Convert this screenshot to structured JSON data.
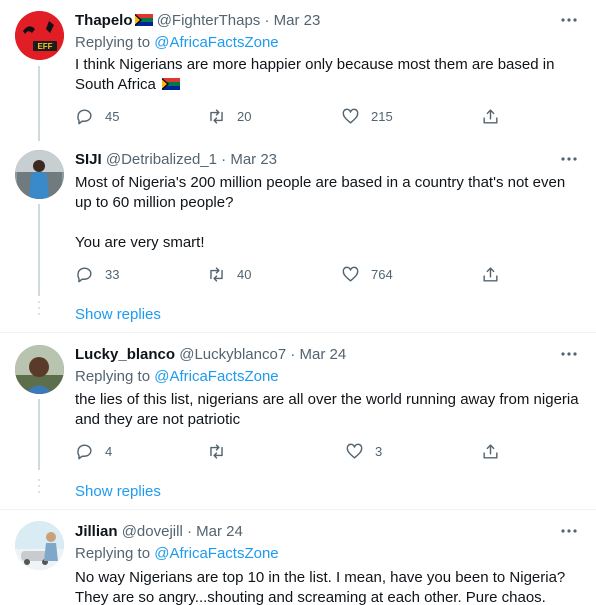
{
  "colors": {
    "accent": "#1d9bf0",
    "muted": "#536471",
    "text": "#0f1419",
    "line": "#cfd9de"
  },
  "tweets": [
    {
      "name": "Thapelo",
      "handle": "@FighterThaps",
      "sep": "·",
      "date": "Mar 23",
      "replying_label": "Replying to",
      "replying_handle": "@AfricaFactsZone",
      "text": "I think Nigerians are more happier only because most them are based in South Africa",
      "reply_count": "45",
      "retweet_count": "20",
      "like_count": "215",
      "avatar_badge": "EFF"
    },
    {
      "name": "SIJI",
      "handle": "@Detribalized_1",
      "sep": "·",
      "date": "Mar 23",
      "text_1": "Most of Nigeria's 200 million people are based in a country that's not even up to 60 million people?",
      "text_2": "You are very smart!",
      "reply_count": "33",
      "retweet_count": "40",
      "like_count": "764",
      "show_replies": "Show replies"
    },
    {
      "name": "Lucky_blanco",
      "handle": "@Luckyblanco7",
      "sep": "·",
      "date": "Mar 24",
      "replying_label": "Replying to",
      "replying_handle": "@AfricaFactsZone",
      "text": "the lies of this list, nigerians are all over the world running away from nigeria and they are not patriotic",
      "reply_count": "4",
      "retweet_count": "",
      "like_count": "3",
      "show_replies": "Show replies"
    },
    {
      "name": "Jillian",
      "handle": "@dovejill",
      "sep": "·",
      "date": "Mar 24",
      "replying_label": "Replying to",
      "replying_handle": "@AfricaFactsZone",
      "text": "No way Nigerians are top 10 in the list. I mean, have you been to Nigeria? They are so angry...shouting and screaming at each other. Pure chaos."
    }
  ]
}
